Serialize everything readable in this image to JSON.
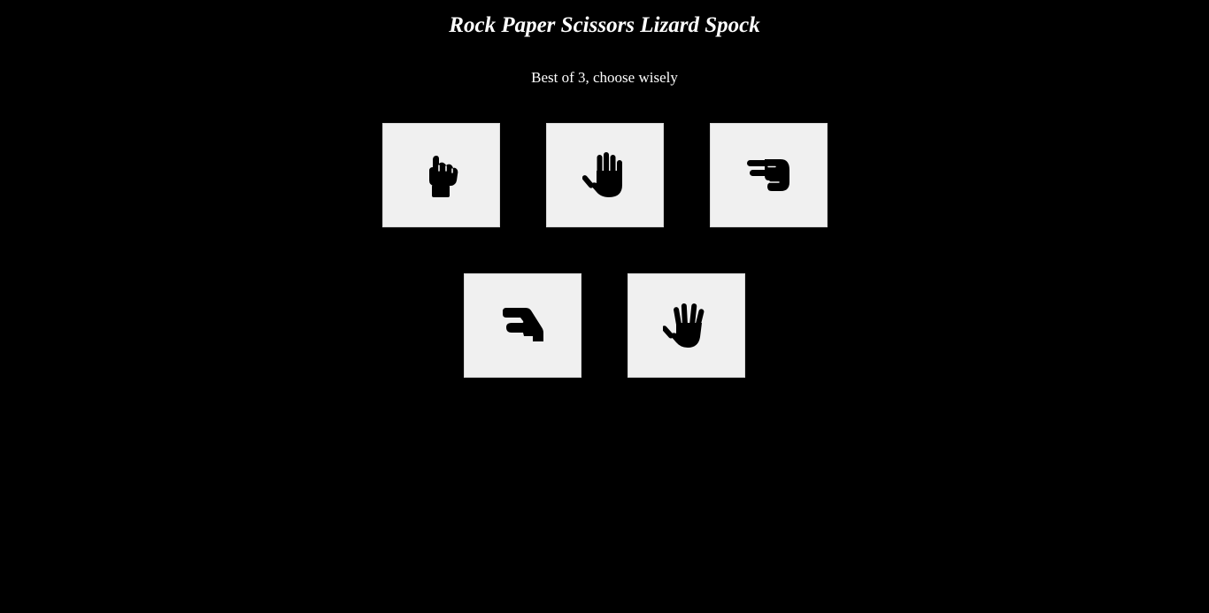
{
  "header": {
    "title": "Rock Paper Scissors Lizard Spock",
    "subtitle": "Best of 3, choose wisely"
  },
  "choices": [
    {
      "id": "rock",
      "icon": "hand-rock-icon"
    },
    {
      "id": "paper",
      "icon": "hand-paper-icon"
    },
    {
      "id": "scissors",
      "icon": "hand-scissors-icon"
    },
    {
      "id": "lizard",
      "icon": "hand-lizard-icon"
    },
    {
      "id": "spock",
      "icon": "hand-spock-icon"
    }
  ],
  "colors": {
    "background": "#000000",
    "text": "#ffffff",
    "tile": "#f0f0f0",
    "icon": "#000000"
  }
}
